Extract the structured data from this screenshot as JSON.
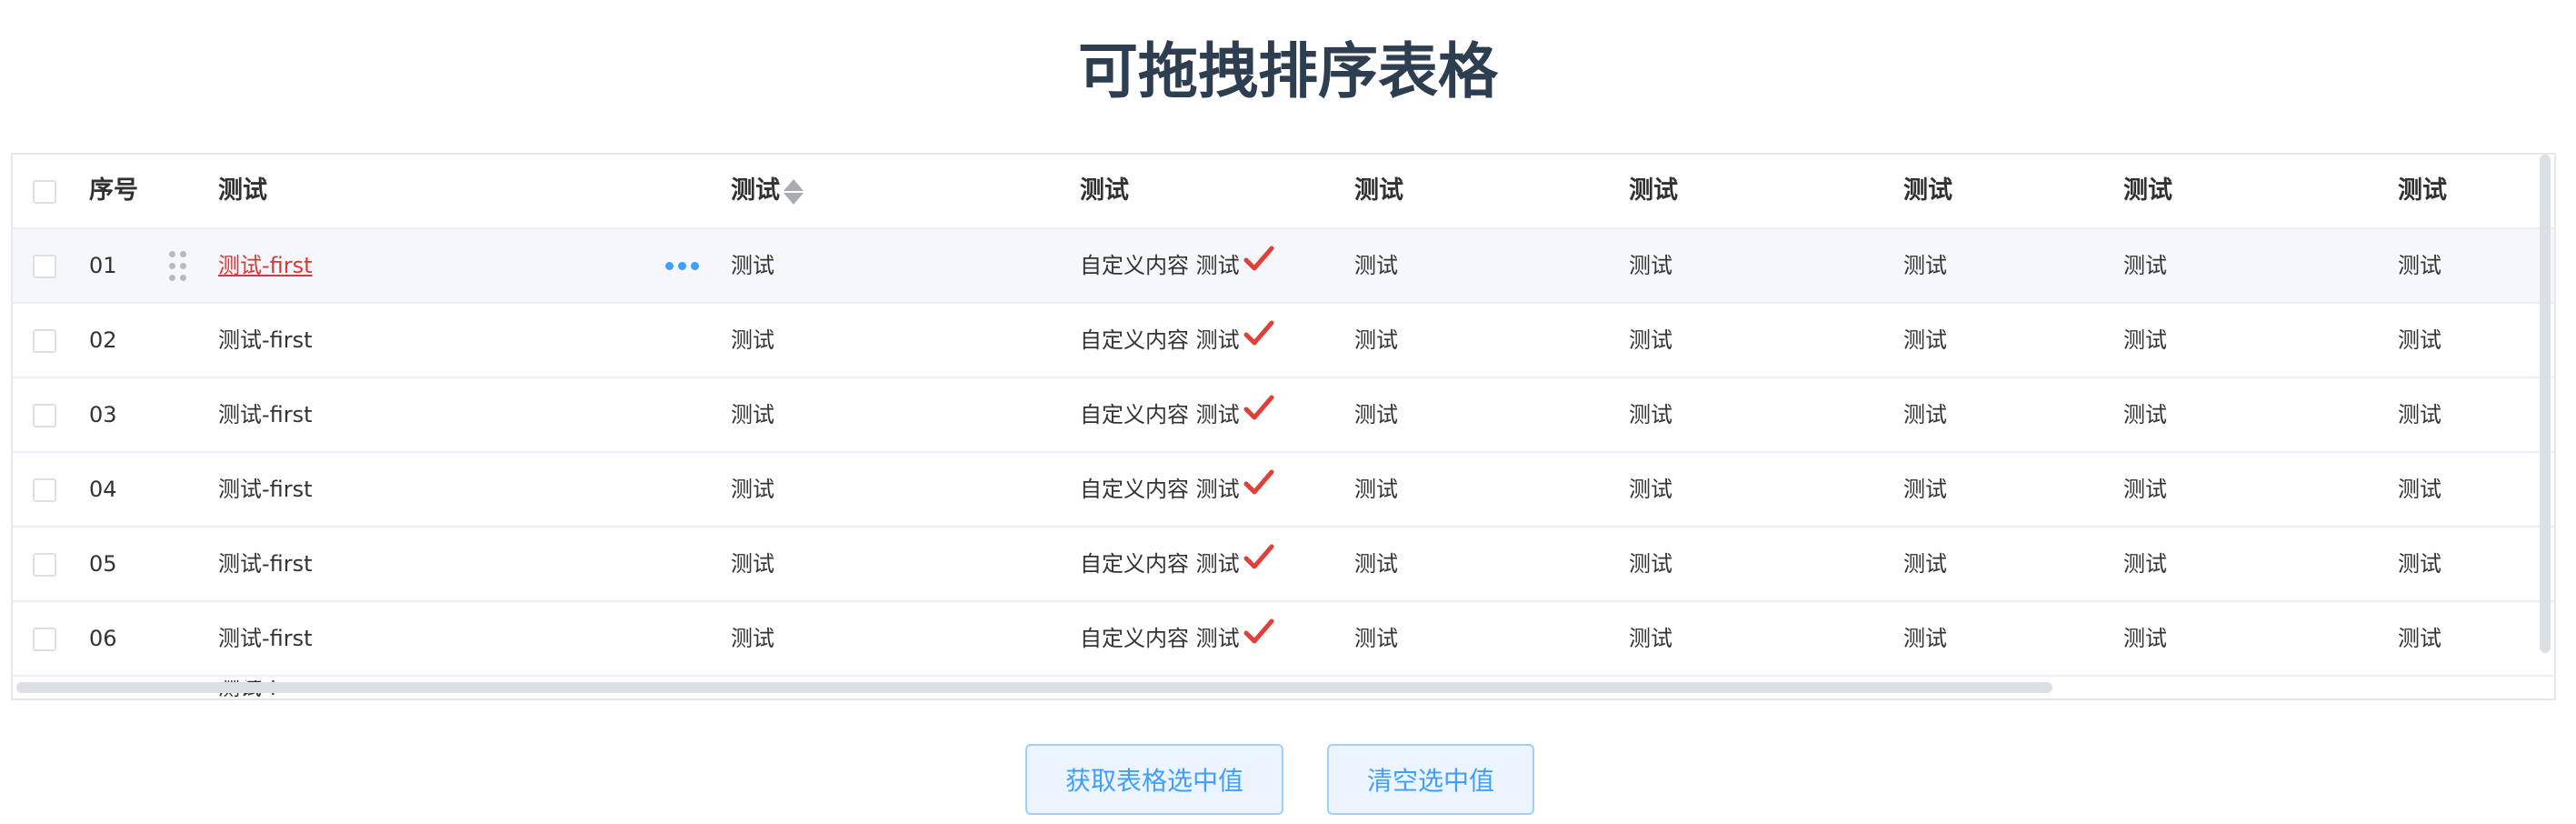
{
  "page": {
    "title": "可拖拽排序表格"
  },
  "table": {
    "headers": {
      "index": "序号",
      "c1": "测试",
      "c2": "测试",
      "c3": "测试",
      "c4": "测试",
      "c5": "测试",
      "c6": "测试",
      "c7": "测试",
      "c8": "测试"
    },
    "rows": [
      {
        "index": "01",
        "name": "测试-first",
        "c2": "测试",
        "c3_text": "自定义内容 测试",
        "c4": "测试",
        "c5": "测试",
        "c6": "测试",
        "c7": "测试",
        "c8": "测试"
      },
      {
        "index": "02",
        "name": "测试-first",
        "c2": "测试",
        "c3_text": "自定义内容 测试",
        "c4": "测试",
        "c5": "测试",
        "c6": "测试",
        "c7": "测试",
        "c8": "测试"
      },
      {
        "index": "03",
        "name": "测试-first",
        "c2": "测试",
        "c3_text": "自定义内容 测试",
        "c4": "测试",
        "c5": "测试",
        "c6": "测试",
        "c7": "测试",
        "c8": "测试"
      },
      {
        "index": "04",
        "name": "测试-first",
        "c2": "测试",
        "c3_text": "自定义内容 测试",
        "c4": "测试",
        "c5": "测试",
        "c6": "测试",
        "c7": "测试",
        "c8": "测试"
      },
      {
        "index": "05",
        "name": "测试-first",
        "c2": "测试",
        "c3_text": "自定义内容 测试",
        "c4": "测试",
        "c5": "测试",
        "c6": "测试",
        "c7": "测试",
        "c8": "测试"
      },
      {
        "index": "06",
        "name": "测试-first",
        "c2": "测试",
        "c3_text": "自定义内容 测试",
        "c4": "测试",
        "c5": "测试",
        "c6": "测试",
        "c7": "测试",
        "c8": "测试"
      }
    ],
    "partial_row_name": "测试-f"
  },
  "buttons": {
    "get_selected": "获取表格选中值",
    "clear_selected": "清空选中值"
  },
  "colors": {
    "accent": "#409eff",
    "link_red": "#d93838",
    "check_red": "#e0403a",
    "title": "#2c3e50"
  },
  "icons": {
    "drag": "drag-handle-icon",
    "more": "more-dots-icon",
    "check": "check-mark-icon",
    "sort": "sort-caret-icon"
  }
}
